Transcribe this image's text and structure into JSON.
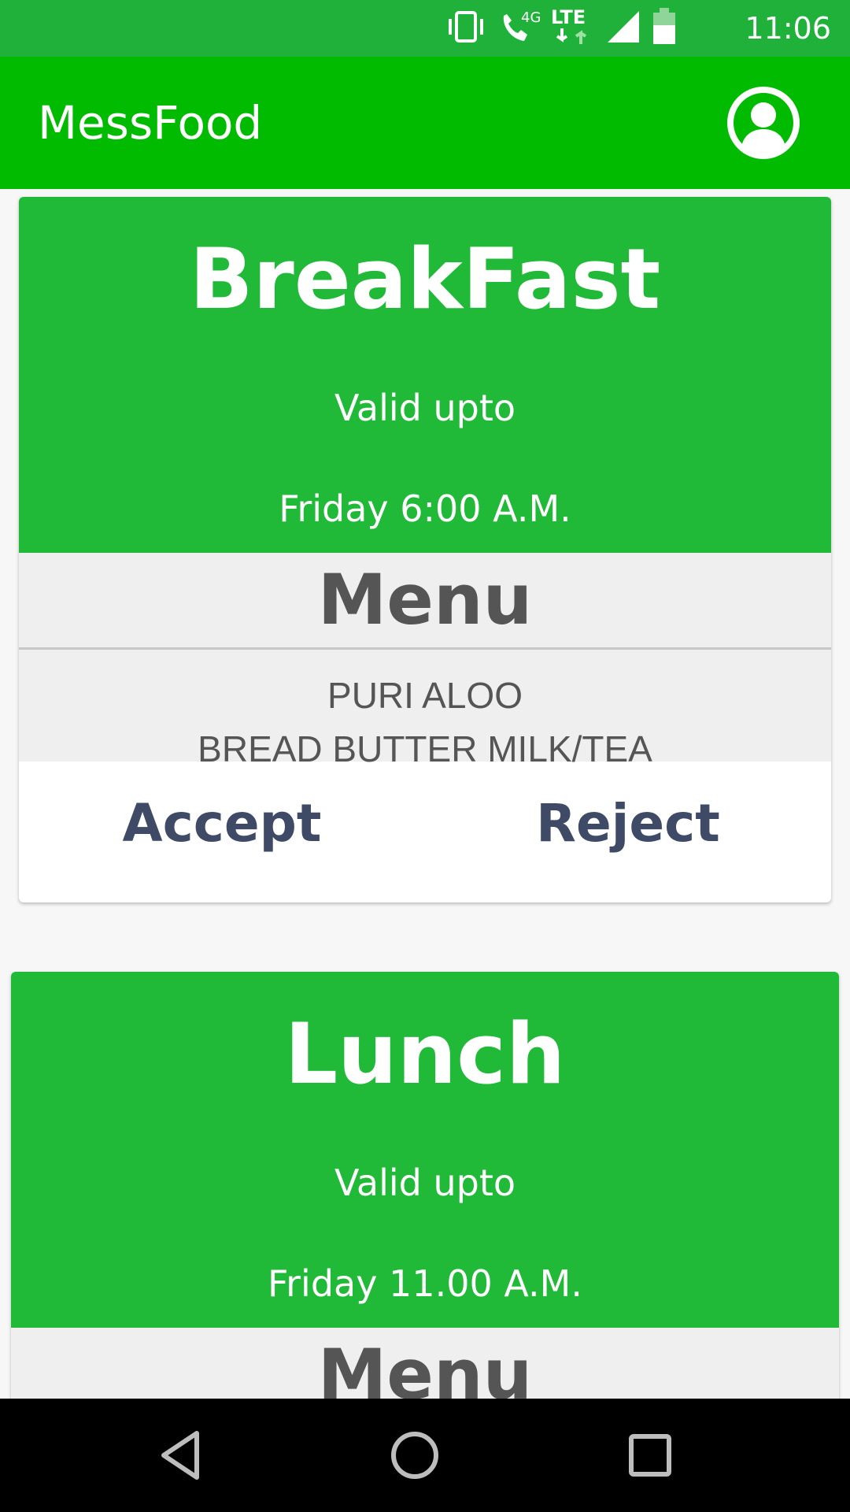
{
  "status_bar": {
    "time": "11:06",
    "network_4g": "4G",
    "network_lte": "LTE",
    "icons": [
      "vibrate-icon",
      "wifi-call-icon",
      "lte-icon",
      "signal-icon",
      "battery-icon"
    ]
  },
  "app_bar": {
    "title": "MessFood",
    "profile_icon": "account-circle-icon"
  },
  "cards": [
    {
      "meal": "BreakFast",
      "valid_label": "Valid upto",
      "valid_time": "Friday 6:00 A.M.",
      "menu_title": "Menu",
      "menu_items": [
        "PURI ALOO",
        "BREAD BUTTER MILK/TEA"
      ],
      "accept_label": "Accept",
      "reject_label": "Reject"
    },
    {
      "meal": "Lunch",
      "valid_label": "Valid upto",
      "valid_time": "Friday 11.00 A.M.",
      "menu_title": "Menu"
    }
  ],
  "nav_bar": {
    "icons": [
      "back-icon",
      "home-icon",
      "recents-icon"
    ]
  },
  "colors": {
    "status_bar": "#1fb13a",
    "app_bar": "#00bb00",
    "card_header": "#21b938",
    "menu_bg": "#efefef",
    "action_text": "#3e4a66"
  }
}
